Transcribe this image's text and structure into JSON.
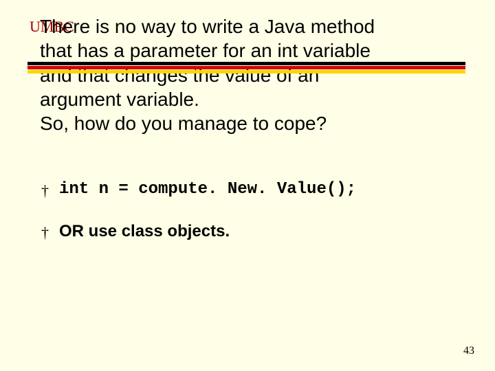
{
  "brand": "UMBC",
  "title": {
    "line1": "There is no way to write a Java method",
    "line2": "that has a parameter for an int variable",
    "line3": "and that changes the value of an",
    "line4": "argument variable.",
    "line5": "So, how do you manage to cope?"
  },
  "bullet_marker": "†",
  "bullets": {
    "b1": "int n = compute. New. Value();",
    "b2": "OR use class objects."
  },
  "page_number": "43"
}
